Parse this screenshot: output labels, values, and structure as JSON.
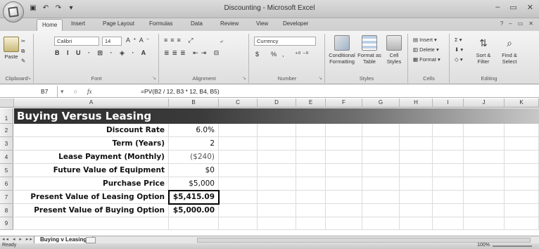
{
  "window": {
    "title": "Discounting - Microsoft Excel",
    "controls": [
      "–",
      "▭",
      "✕"
    ]
  },
  "ribbon": {
    "tabs": [
      "Home",
      "Insert",
      "Page Layout",
      "Formulas",
      "Data",
      "Review",
      "View",
      "Developer"
    ],
    "active_tab": "Home",
    "clipboard": {
      "paste": "Paste",
      "label": "Clipboard"
    },
    "font": {
      "family": "Calibri",
      "size": "14",
      "label": "Font"
    },
    "alignment": {
      "label": "Alignment"
    },
    "number": {
      "format": "Currency",
      "dollar": "$",
      "percent": "%",
      "comma": ",",
      "label": "Number"
    },
    "styles": {
      "conditional": "Conditional Formatting",
      "format_table": "Format as Table",
      "cell_styles": "Cell Styles",
      "label": "Styles"
    },
    "cells": {
      "insert": "Insert",
      "delete": "Delete",
      "format": "Format",
      "label": "Cells"
    },
    "editing": {
      "sort": "Sort & Filter",
      "find": "Find & Select",
      "label": "Editing"
    }
  },
  "formula_bar": {
    "name_box": "B7",
    "fx": "fx",
    "formula": "=PV(B2 / 12, B3 * 12, B4, B5)"
  },
  "sheet": {
    "columns": [
      "A",
      "B",
      "C",
      "D",
      "E",
      "F",
      "G",
      "H",
      "I",
      "J",
      "K"
    ],
    "rows": [
      "1",
      "2",
      "3",
      "4",
      "5",
      "6",
      "7",
      "8",
      "9"
    ],
    "title": "Buying Versus Leasing",
    "labels": [
      "Discount Rate",
      "Term (Years)",
      "Lease Payment (Monthly)",
      "Future Value of Equipment",
      "Purchase Price",
      "Present Value of  Leasing Option",
      "Present Value of  Buying Option"
    ],
    "values": [
      "6.0%",
      "2",
      "($240)",
      "$0",
      "$5,000",
      "$5,415.09",
      "$5,000.00"
    ],
    "selected_cell": "B7"
  },
  "sheet_tabs": {
    "active": "Buying v Leasing"
  },
  "status": {
    "mode": "Ready",
    "zoom": "100%"
  }
}
